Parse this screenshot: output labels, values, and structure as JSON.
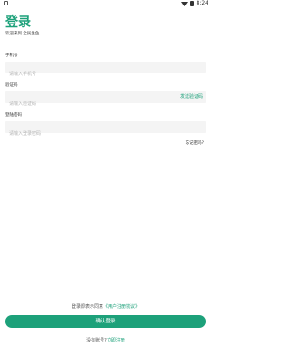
{
  "status_bar": {
    "time": "8:24"
  },
  "header": {
    "title": "登录",
    "subtitle": "欢迎来到 全民生鱼"
  },
  "phone": {
    "label": "手机号",
    "placeholder": "请输入手机号"
  },
  "code": {
    "label": "验证码",
    "placeholder": "请输入验证码",
    "send_label": "发送验证码"
  },
  "password": {
    "label": "登陆密码",
    "placeholder": "请输入登录密码"
  },
  "forgot_label": "忘记密码?",
  "agreement": {
    "prefix": "登录即表示同意",
    "link": "《用户注册协议》"
  },
  "confirm_label": "确认登录",
  "register": {
    "prefix": "没有账号?",
    "link": "立即注册"
  },
  "colors": {
    "accent": "#1da17a",
    "field_bg": "#f4f4f4"
  }
}
